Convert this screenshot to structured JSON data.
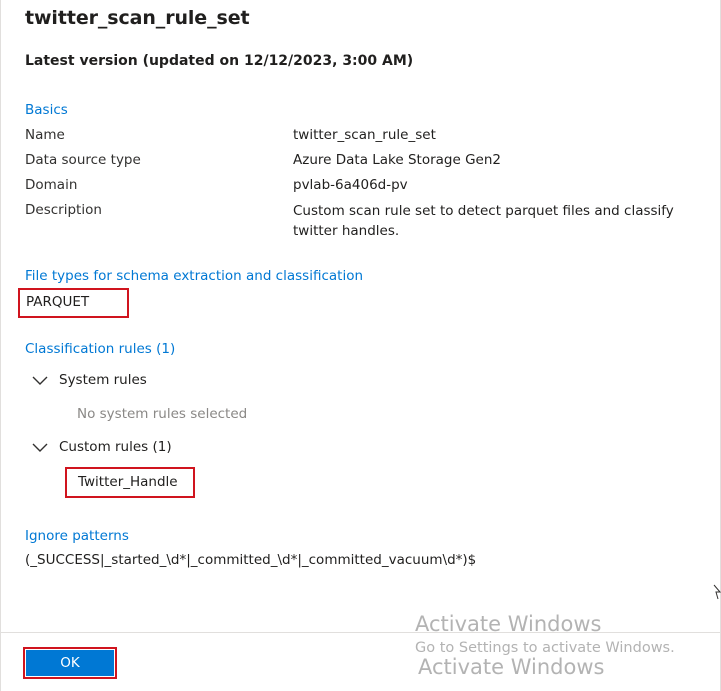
{
  "panel": {
    "title": "twitter_scan_rule_set",
    "version_line": "Latest version (updated on 12/12/2023, 3:00 AM)"
  },
  "basics": {
    "heading": "Basics",
    "rows": [
      {
        "label": "Name",
        "value": "twitter_scan_rule_set"
      },
      {
        "label": "Data source type",
        "value": "Azure Data Lake Storage Gen2"
      },
      {
        "label": "Domain",
        "value": "pvlab-6a406d-pv"
      },
      {
        "label": "Description",
        "value": "Custom scan rule set to detect parquet files and classify twitter handles."
      }
    ]
  },
  "file_types": {
    "heading": "File types for schema extraction and classification",
    "values": [
      "PARQUET"
    ]
  },
  "classification": {
    "heading": "Classification rules (1)",
    "system_rules": {
      "label": "System rules",
      "empty_text": "No system rules selected"
    },
    "custom_rules": {
      "label": "Custom rules (1)",
      "items": [
        "Twitter_Handle"
      ]
    }
  },
  "ignore_patterns": {
    "heading": "Ignore patterns",
    "value": "(_SUCCESS|_started_\\d*|_committed_\\d*|_committed_vacuum\\d*)$"
  },
  "footer": {
    "ok_label": "OK"
  },
  "watermark": {
    "line1": "Activate Windows",
    "line2": "Go to Settings to activate Windows.",
    "line3": "Activate Windows"
  },
  "colors": {
    "accent": "#0078d4",
    "highlight_box": "#d0141e",
    "muted_text": "#8a8886"
  },
  "icons": [
    "chevron-down-icon",
    "chevron-down-icon",
    "mouse-cursor-icon"
  ]
}
